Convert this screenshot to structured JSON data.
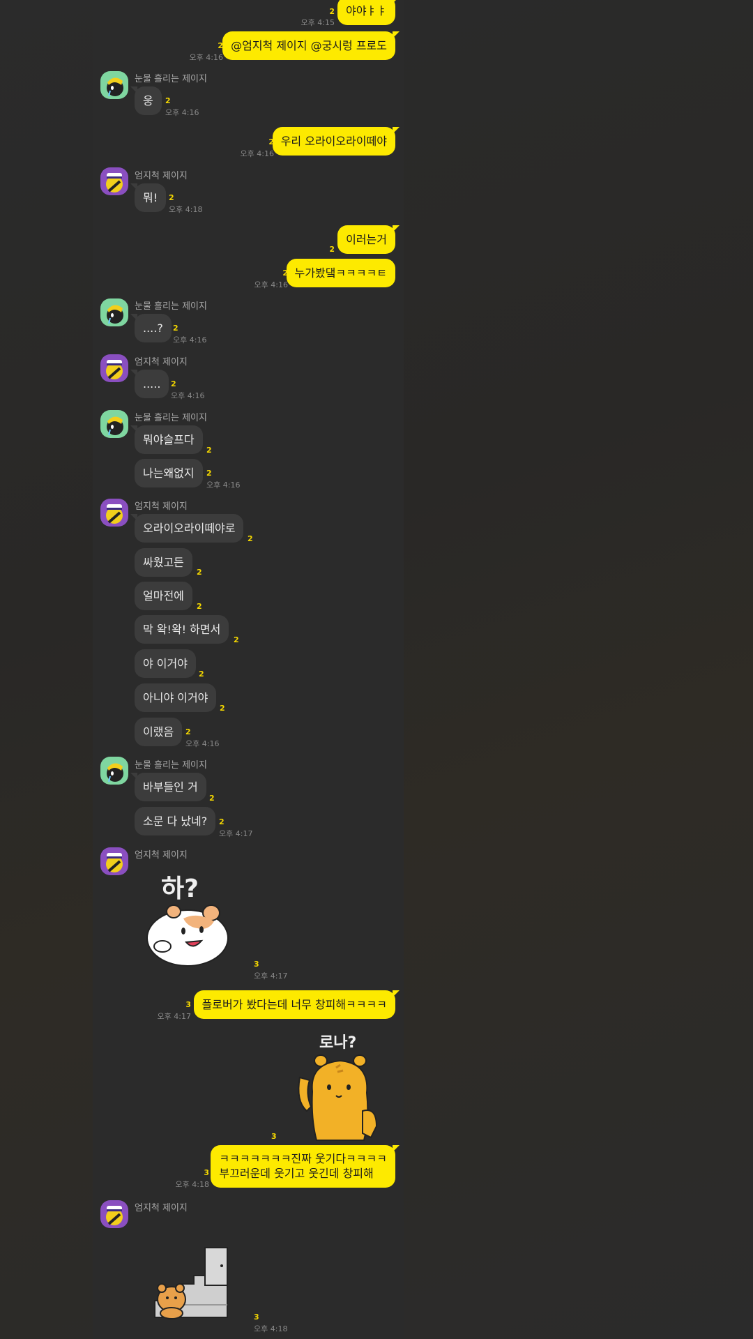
{
  "chat": {
    "senders": {
      "tears": "눈물 흘리는 제이지",
      "strict": "엄지척 제이지"
    },
    "messages": [
      {
        "from": "me",
        "text": "야야ㅑㅑ",
        "unread": "2",
        "time": "오후 4:15"
      },
      {
        "from": "me",
        "text": "@엄지척 제이지 @궁시렁 프로도",
        "unread": "2",
        "time": "오후 4:16"
      },
      {
        "from": "tears",
        "text": "웅",
        "unread": "2",
        "time": "오후 4:16"
      },
      {
        "from": "me",
        "text": "우리 오라이오라이떼야",
        "unread": "2",
        "time": "오후 4:16"
      },
      {
        "from": "strict",
        "text": "뭐!",
        "unread": "2",
        "time": "오후 4:18"
      },
      {
        "from": "me",
        "text": "이러는거",
        "unread": "2"
      },
      {
        "from": "me",
        "text": "누가봤댘ㅋㅋㅋㅋㅌ",
        "unread": "2",
        "time": "오후 4:16"
      },
      {
        "from": "tears",
        "text": "....?",
        "unread": "2",
        "time": "오후 4:16"
      },
      {
        "from": "strict",
        "text": ".....",
        "unread": "2",
        "time": "오후 4:16"
      },
      {
        "from": "tears",
        "text": "뭐야슬프다",
        "unread": "2"
      },
      {
        "from": "tears",
        "text": "나는왜없지",
        "unread": "2",
        "time": "오후 4:16"
      },
      {
        "from": "strict",
        "text": "오라이오라이떼야로",
        "unread": "2"
      },
      {
        "from": "strict",
        "text": "싸웠고든",
        "unread": "2"
      },
      {
        "from": "strict",
        "text": "얼마전에",
        "unread": "2"
      },
      {
        "from": "strict",
        "text": "막 왁!왁! 하면서",
        "unread": "2"
      },
      {
        "from": "strict",
        "text": "야 이거야",
        "unread": "2"
      },
      {
        "from": "strict",
        "text": "아니야 이거야",
        "unread": "2"
      },
      {
        "from": "strict",
        "text": "이랬음",
        "unread": "2",
        "time": "오후 4:16"
      },
      {
        "from": "tears",
        "text": "바부들인 거",
        "unread": "2"
      },
      {
        "from": "tears",
        "text": "소문 다 났네?",
        "unread": "2",
        "time": "오후 4:17"
      },
      {
        "from": "strict",
        "sticker": "hamster-sticker",
        "sticker_text": "하?",
        "unread": "3",
        "time": "오후 4:17"
      },
      {
        "from": "me",
        "text": "플로버가 봤다는데 너무 창피해ㅋㅋㅋㅋ",
        "unread": "3",
        "time": "오후 4:17"
      },
      {
        "from": "me",
        "sticker": "tiger-sticker",
        "sticker_text": "로나?",
        "unread": "3"
      },
      {
        "from": "me",
        "text_line1": "ㅋㅋㅋㅋㅋㅋㅋ진짜 웃기다ㅋㅋㅋㅋ",
        "text_line2": "부끄러운데 웃기고 웃긴데 창피해",
        "unread": "3",
        "time": "오후 4:18"
      },
      {
        "from": "strict",
        "sticker": "bear-stairs-sticker",
        "unread": "3",
        "time": "오후 4:18"
      }
    ]
  },
  "colors": {
    "my_bubble": "#fdea00",
    "other_bubble": "#3c3c3c",
    "chat_bg": "#2b2b2b",
    "unread": "#f5d800"
  }
}
